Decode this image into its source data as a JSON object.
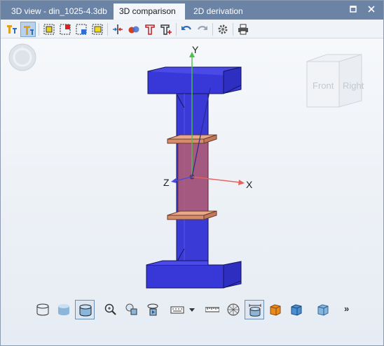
{
  "tabs": [
    {
      "label": "3D view - din_1025-4.3db",
      "active": false
    },
    {
      "label": "3D comparison",
      "active": true
    },
    {
      "label": "2D derivation",
      "active": false
    }
  ],
  "tab_controls": {
    "maximize_icon": "maximize-icon",
    "close_icon": "close-icon",
    "close_glyph": "✕",
    "maximize_glyph": "□"
  },
  "toolbar": {
    "items": [
      {
        "name": "filter-tool-icon",
        "pressed": false
      },
      {
        "name": "filter-tool-active-icon",
        "pressed": true
      },
      {
        "name": "select-all-icon",
        "pressed": false
      },
      {
        "name": "select-red-icon",
        "pressed": false
      },
      {
        "name": "select-blue-icon",
        "pressed": false
      },
      {
        "name": "select-yellow-icon",
        "pressed": false
      },
      {
        "name": "split-view-icon",
        "pressed": false
      },
      {
        "name": "color-compare-icon",
        "pressed": false
      },
      {
        "name": "profile-t-icon",
        "pressed": false
      },
      {
        "name": "profile-t-plus-icon",
        "pressed": false
      },
      {
        "name": "undo-icon",
        "pressed": false
      },
      {
        "name": "redo-icon",
        "pressed": false
      },
      {
        "name": "settings-gear-icon",
        "pressed": false
      },
      {
        "name": "print-icon",
        "pressed": false
      }
    ]
  },
  "viewport": {
    "axes": {
      "x": "X",
      "y": "Y",
      "z": "Z"
    },
    "view_cube": {
      "front": "Front",
      "right": "Right"
    },
    "colors": {
      "beam": "#3f3fe0",
      "beam_dark": "#2b2bb0",
      "stiffener": "#e8a98a",
      "x_axis": "#e86060",
      "y_axis": "#4cc04c",
      "z_axis": "#4a4adf"
    }
  },
  "bottom_toolbar": {
    "items": [
      {
        "name": "wireframe-cylinder-icon",
        "pressed": false
      },
      {
        "name": "shaded-cylinder-icon",
        "pressed": false
      },
      {
        "name": "shaded-edges-cylinder-icon",
        "pressed": true
      },
      {
        "name": "zoom-icon",
        "pressed": false
      },
      {
        "name": "zoom-fit-icon",
        "pressed": false
      },
      {
        "name": "rotate-icon",
        "pressed": false
      },
      {
        "name": "keyboard-icon",
        "pressed": false
      },
      {
        "name": "dropdown-arrow-icon",
        "pressed": false
      },
      {
        "name": "measure-ruler-icon",
        "pressed": false
      },
      {
        "name": "mesh-sphere-icon",
        "pressed": false
      },
      {
        "name": "section-measure-icon",
        "pressed": true
      },
      {
        "name": "orange-cube-icon",
        "pressed": false
      },
      {
        "name": "blue-cube-icon",
        "pressed": false
      },
      {
        "name": "transparent-cube-icon",
        "pressed": false
      }
    ],
    "more_label": "»"
  }
}
